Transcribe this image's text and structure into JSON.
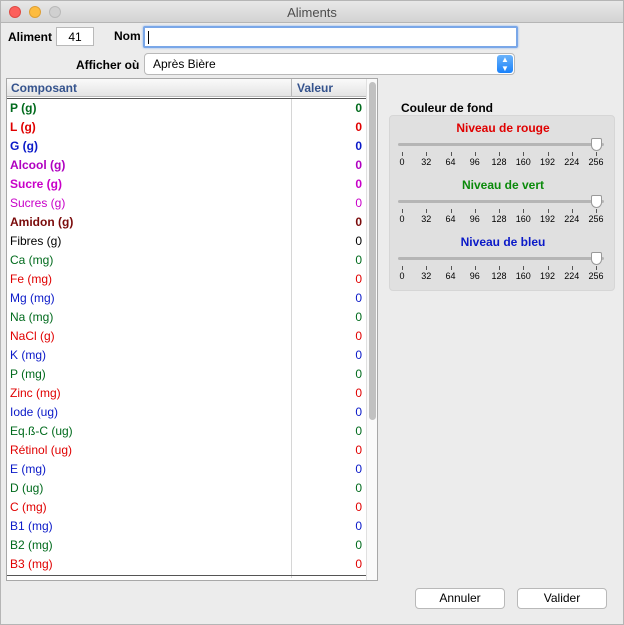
{
  "window": {
    "title": "Aliments"
  },
  "header": {
    "aliment_label": "Aliment",
    "aliment_value": "41",
    "nom_label": "Nom",
    "nom_value": "",
    "afficher_label": "Afficher où",
    "afficher_value": "Après Bière"
  },
  "table": {
    "col_composant": "Composant",
    "col_valeur": "Valeur",
    "rows": [
      {
        "name": "P (g)",
        "value": "0",
        "color": "#006a1c",
        "bold": true
      },
      {
        "name": "L (g)",
        "value": "0",
        "color": "#e00000",
        "bold": true
      },
      {
        "name": "G (g)",
        "value": "0",
        "color": "#0a19c8",
        "bold": true
      },
      {
        "name": "Alcool (g)",
        "value": "0",
        "color": "#b000c0",
        "bold": true
      },
      {
        "name": "Sucre (g)",
        "value": "0",
        "color": "#c800c8",
        "bold": true
      },
      {
        "name": "Sucres (g)",
        "value": "0",
        "color": "#c800c8",
        "bold": false
      },
      {
        "name": "Amidon (g)",
        "value": "0",
        "color": "#7a0a0a",
        "bold": true
      },
      {
        "name": "Fibres (g)",
        "value": "0",
        "color": "#000000",
        "bold": false
      },
      {
        "name": "Ca (mg)",
        "value": "0",
        "color": "#006a1c",
        "bold": false
      },
      {
        "name": "Fe (mg)",
        "value": "0",
        "color": "#e00000",
        "bold": false
      },
      {
        "name": "Mg (mg)",
        "value": "0",
        "color": "#0a19c8",
        "bold": false
      },
      {
        "name": "Na (mg)",
        "value": "0",
        "color": "#006a1c",
        "bold": false
      },
      {
        "name": "NaCl (g)",
        "value": "0",
        "color": "#e00000",
        "bold": false
      },
      {
        "name": "K (mg)",
        "value": "0",
        "color": "#0a19c8",
        "bold": false
      },
      {
        "name": "P (mg)",
        "value": "0",
        "color": "#006a1c",
        "bold": false
      },
      {
        "name": "Zinc (mg)",
        "value": "0",
        "color": "#e00000",
        "bold": false
      },
      {
        "name": "Iode (ug)",
        "value": "0",
        "color": "#0a19c8",
        "bold": false
      },
      {
        "name": "Eq.ß-C (ug)",
        "value": "0",
        "color": "#006a1c",
        "bold": false
      },
      {
        "name": "Rétinol (ug)",
        "value": "0",
        "color": "#e00000",
        "bold": false
      },
      {
        "name": "E (mg)",
        "value": "0",
        "color": "#0a19c8",
        "bold": false
      },
      {
        "name": "D (ug)",
        "value": "0",
        "color": "#006a1c",
        "bold": false
      },
      {
        "name": "C (mg)",
        "value": "0",
        "color": "#e00000",
        "bold": false
      },
      {
        "name": "B1 (mg)",
        "value": "0",
        "color": "#0a19c8",
        "bold": false
      },
      {
        "name": "B2 (mg)",
        "value": "0",
        "color": "#006a1c",
        "bold": false
      },
      {
        "name": "B3 (mg)",
        "value": "0",
        "color": "#e00000",
        "bold": false
      }
    ]
  },
  "couleur": {
    "title": "Couleur de fond",
    "tick_labels": [
      "0",
      "32",
      "64",
      "96",
      "128",
      "160",
      "192",
      "224",
      "256"
    ],
    "sliders": [
      {
        "label": "Niveau de rouge",
        "color": "#e00000",
        "value": 256
      },
      {
        "label": "Niveau de vert",
        "color": "#0a8a0a",
        "value": 256
      },
      {
        "label": "Niveau de bleu",
        "color": "#0a19c8",
        "value": 256
      }
    ]
  },
  "buttons": {
    "annuler": "Annuler",
    "valider": "Valider"
  }
}
